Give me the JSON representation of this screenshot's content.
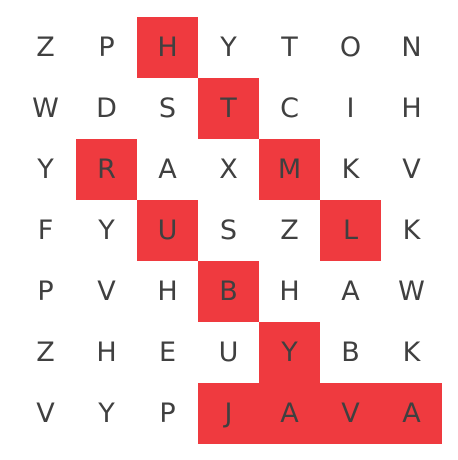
{
  "puzzle": {
    "highlight_color": "#ef3a3f",
    "rows": [
      [
        "Z",
        "P",
        "H",
        "Y",
        "T",
        "O",
        "N"
      ],
      [
        "W",
        "D",
        "S",
        "T",
        "C",
        "I",
        "H"
      ],
      [
        "Y",
        "R",
        "A",
        "X",
        "M",
        "K",
        "V"
      ],
      [
        "F",
        "Y",
        "U",
        "S",
        "Z",
        "L",
        "K"
      ],
      [
        "P",
        "V",
        "H",
        "B",
        "H",
        "A",
        "W"
      ],
      [
        "Z",
        "H",
        "E",
        "U",
        "Y",
        "B",
        "K"
      ],
      [
        "V",
        "Y",
        "P",
        "J",
        "A",
        "V",
        "A"
      ]
    ],
    "highlighted": [
      [
        0,
        2
      ],
      [
        1,
        3
      ],
      [
        2,
        4
      ],
      [
        3,
        5
      ],
      [
        2,
        1
      ],
      [
        3,
        2
      ],
      [
        4,
        3
      ],
      [
        5,
        4
      ],
      [
        6,
        3
      ],
      [
        6,
        4
      ],
      [
        6,
        5
      ],
      [
        6,
        6
      ]
    ]
  }
}
